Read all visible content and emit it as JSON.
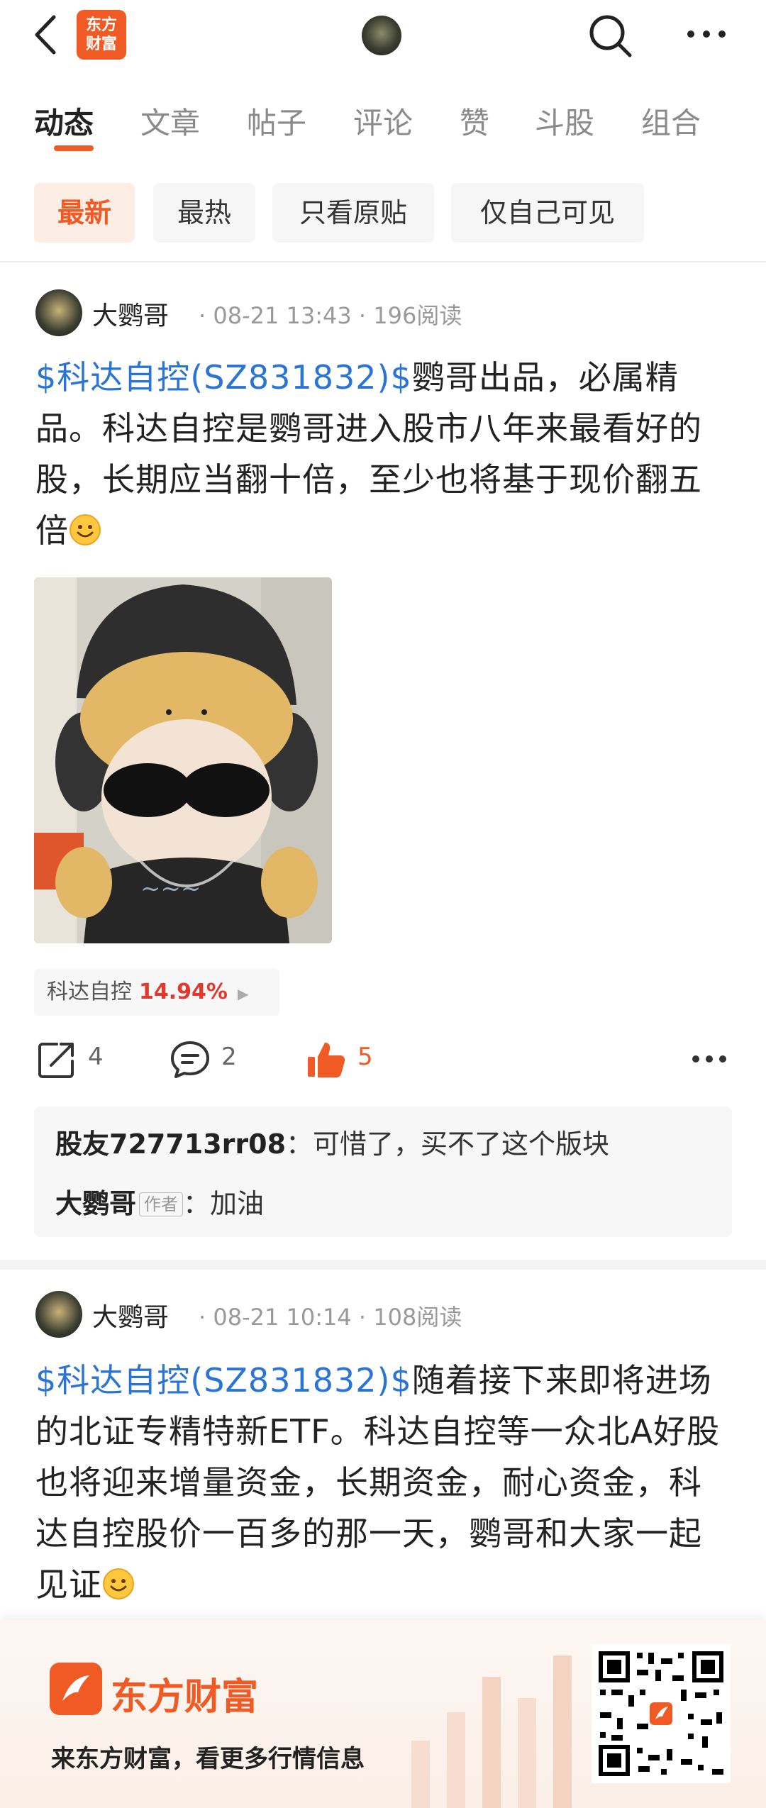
{
  "header": {
    "logo_text_line1": "东方",
    "logo_text_line2": "财富",
    "back_icon": "chevron-left-icon",
    "search_icon": "search-icon",
    "more_icon": "ellipsis-icon"
  },
  "tabs": [
    {
      "label": "动态",
      "active": true
    },
    {
      "label": "文章"
    },
    {
      "label": "帖子"
    },
    {
      "label": "评论"
    },
    {
      "label": "赞"
    },
    {
      "label": "斗股"
    },
    {
      "label": "组合"
    }
  ],
  "filters": [
    {
      "label": "最新",
      "active": true
    },
    {
      "label": "最热"
    },
    {
      "label": "只看原贴"
    },
    {
      "label": "仅自己可见"
    }
  ],
  "posts": [
    {
      "author": "大鹦哥",
      "meta": "· 08-21 13:43 · 196阅读",
      "stock_tag": "$科达自控(SZ831832)$",
      "body": "鹦哥出品，必属精品。科达自控是鹦哥进入股市八年来最看好的股，长期应当翻十倍，至少也将基于现价翻五倍",
      "stock_chip": {
        "name": "科达自控",
        "change": "14.94%"
      },
      "actions": {
        "share": "4",
        "comment": "2",
        "like": "5"
      },
      "comments": [
        {
          "user": "股友727713rr08",
          "sep": "：",
          "text": "可惜了，买不了这个版块"
        },
        {
          "user": "大鹦哥",
          "tag": "作者",
          "sep": "：",
          "text": "加油"
        }
      ]
    },
    {
      "author": "大鹦哥",
      "meta": "· 08-21 10:14 · 108阅读",
      "stock_tag": "$科达自控(SZ831832)$",
      "body": "随着接下来即将进场的北证专精特新ETF。科达自控等一众北A好股也将迎来增量资金，长期资金，耐心资金，科达自控股价一百多的那一天，鹦哥和大家一起见证"
    }
  ],
  "footer": {
    "brand": "东方财富",
    "slogan": "来东方财富，看更多行情信息"
  },
  "colors": {
    "accent": "#f05a24",
    "link": "#2a74d5",
    "up": "#e03a2f"
  }
}
